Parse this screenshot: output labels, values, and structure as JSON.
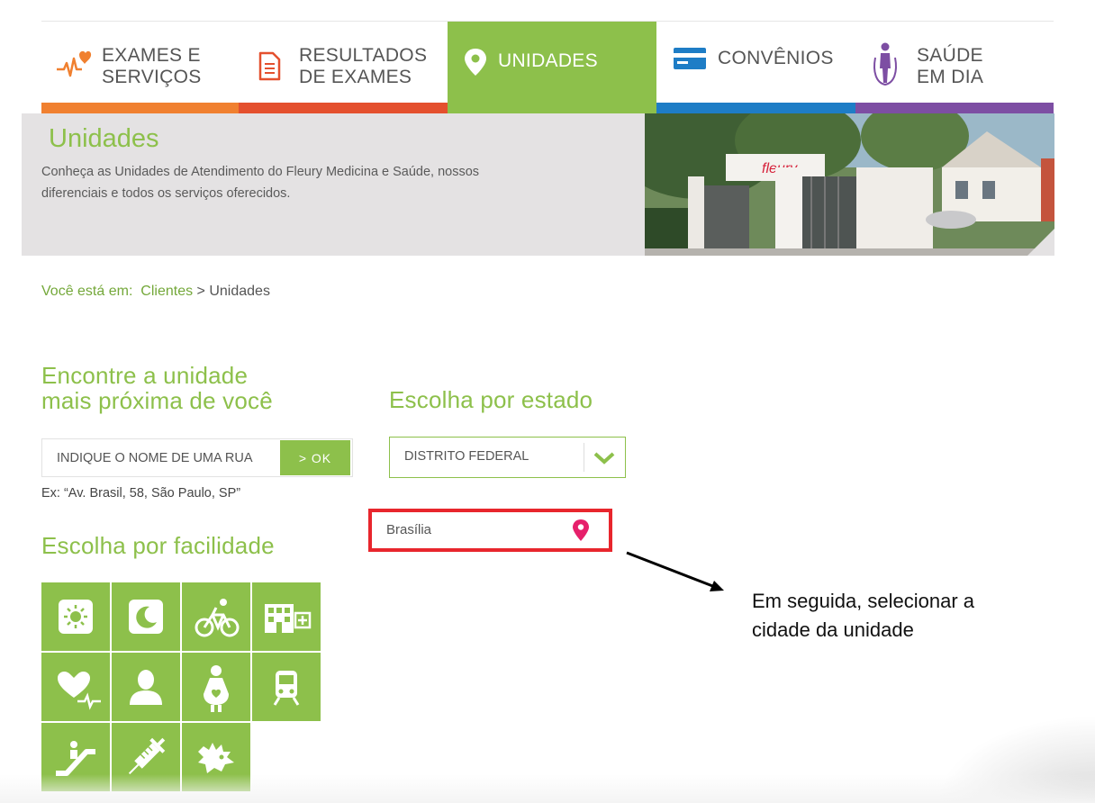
{
  "nav": {
    "tabs": [
      {
        "label": "EXAMES E\nSERVIÇOS",
        "icon": "heart-pulse-icon",
        "color": "#f08030"
      },
      {
        "label": "RESULTADOS\nDE EXAMES",
        "icon": "document-icon",
        "color": "#e4502e"
      },
      {
        "label": "UNIDADES",
        "icon": "map-pin-icon",
        "color": "#8dc04b",
        "active": true
      },
      {
        "label": "CONVÊNIOS",
        "icon": "credit-card-icon",
        "color": "#1e7dc6"
      },
      {
        "label": "SAÚDE\nEM DIA",
        "icon": "jump-rope-person-icon",
        "color": "#7d4ea3"
      }
    ]
  },
  "hero": {
    "title": "Unidades",
    "description": "Conheça as Unidades de Atendimento do Fleury Medicina e Saúde, nossos diferenciais e todos os serviços oferecidos."
  },
  "breadcrumb": {
    "prefix": "Você está em:",
    "link": "Clientes",
    "separator": ">",
    "current": "Unidades"
  },
  "search": {
    "heading": "Encontre a unidade\nmais próxima de você",
    "placeholder": "INDIQUE O NOME DE UMA RUA",
    "button_label": "> OK",
    "example": "Ex: “Av. Brasil, 58, São Paulo, SP”"
  },
  "state": {
    "heading": "Escolha por estado",
    "selected": "DISTRITO FEDERAL"
  },
  "city": {
    "selected": "Brasília"
  },
  "facility": {
    "heading": "Escolha por facilidade",
    "icons": [
      "sun-icon",
      "moon-icon",
      "bicycle-icon",
      "hospital-building-icon",
      "heart-pulse-icon",
      "person-icon",
      "pregnant-woman-icon",
      "train-icon",
      "escalator-icon",
      "syringe-icon",
      "dragon-icon"
    ]
  },
  "annotation": {
    "text": "Em seguida, selecionar a\ncidade da unidade"
  },
  "colors": {
    "brand_green": "#8dc04b",
    "highlight_red": "#e8262d",
    "pin_pink": "#e6206b"
  }
}
